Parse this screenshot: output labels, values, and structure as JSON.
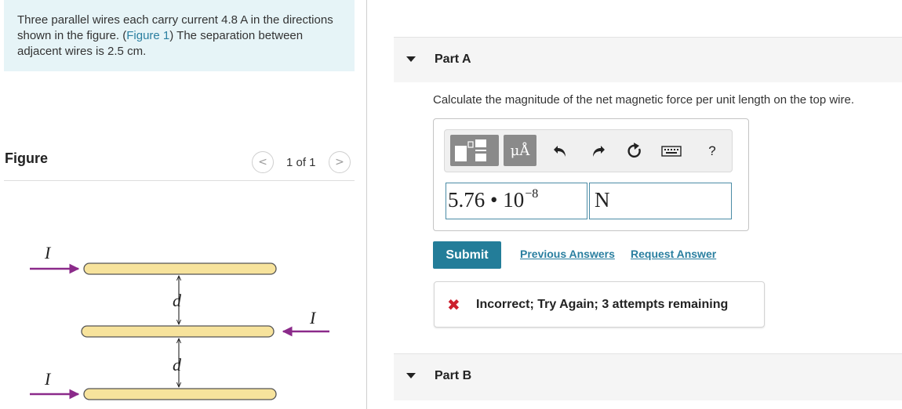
{
  "problem": {
    "text_before_link": "Three parallel wires each carry current 4.8 A in the directions shown in the figure. (",
    "figure_link": "Figure 1",
    "text_after_link": ") The separation between adjacent wires is  2.5 cm."
  },
  "figure_panel": {
    "title": "Figure",
    "page_count": "1 of 1",
    "prev_label": "<",
    "next_label": ">",
    "labels": {
      "current_top": "I",
      "current_middle": "I",
      "current_bottom": "I",
      "separation_upper": "d",
      "separation_lower": "d"
    },
    "colors": {
      "wire_fill": "#f7e39c",
      "wire_stroke": "#555555",
      "arrow": "#8b2a8a"
    }
  },
  "part_a": {
    "label": "Part A",
    "question": "Calculate the magnitude of the net magnetic force per unit length on the top wire.",
    "toolbar": {
      "units_label": "μÅ",
      "icons": [
        "templates-icon",
        "units-icon",
        "undo-icon",
        "redo-icon",
        "reset-icon",
        "keyboard-icon",
        "help-icon"
      ],
      "help_label": "?"
    },
    "answer": {
      "mantissa": "5.76",
      "times": "•",
      "base": "10",
      "exponent": "−8",
      "unit": "N"
    },
    "submit_label": "Submit",
    "previous_answers_label": "Previous Answers",
    "request_answer_label": "Request Answer",
    "feedback": {
      "icon": "✖",
      "text": "Incorrect; Try Again; 3 attempts remaining"
    }
  },
  "part_b": {
    "label": "Part B"
  },
  "colors": {
    "problem_bg": "#e6f4f7",
    "accent": "#237d99",
    "link": "#2a7fa0",
    "error": "#cc1f2d"
  }
}
